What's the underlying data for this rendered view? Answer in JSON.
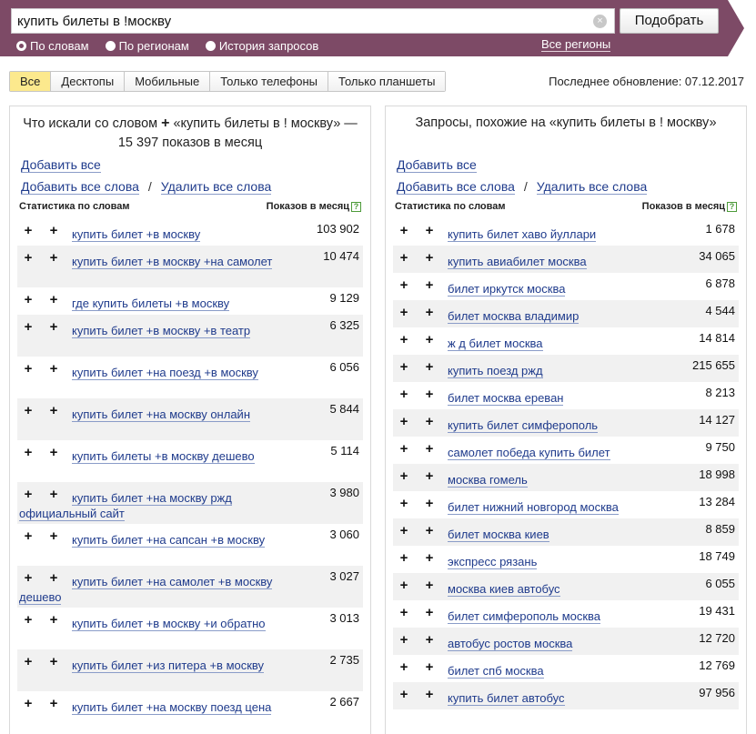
{
  "search": {
    "value": "купить билеты в !москву",
    "submit_label": "Подобрать",
    "modes": [
      {
        "label": "По словам",
        "checked": true
      },
      {
        "label": "По регионам",
        "checked": false
      },
      {
        "label": "История запросов",
        "checked": false
      }
    ],
    "all_regions_label": "Все регионы"
  },
  "device_tabs": [
    {
      "label": "Все",
      "active": true
    },
    {
      "label": "Десктопы",
      "active": false
    },
    {
      "label": "Мобильные",
      "active": false
    },
    {
      "label": "Только телефоны",
      "active": false
    },
    {
      "label": "Только планшеты",
      "active": false
    }
  ],
  "last_update": "Последнее обновление: 07.12.2017",
  "colors": {
    "accent": "#7d4a66",
    "link": "#1f3b8c",
    "active_tab": "#fce98d"
  },
  "left_panel": {
    "title_before": "Что искали со словом",
    "title_after": "«купить билеты в ! москву» — 15 397 показов в месяц",
    "add_all": "Добавить все",
    "add_all_words": "Добавить все слова",
    "separator": "/",
    "delete_all_words": "Удалить все слова",
    "col_stats": "Статистика по словам",
    "col_impressions": "Показов в месяц",
    "help_label": "?",
    "rows": [
      {
        "phrase": "купить билет +в москву",
        "count": "103 902"
      },
      {
        "phrase": "купить билет +в москву +на самолет",
        "count": "10 474"
      },
      {
        "phrase": "где купить билеты +в москву",
        "count": "9 129"
      },
      {
        "phrase": "купить билет +в москву +в театр",
        "count": "6 325"
      },
      {
        "phrase": "купить билет +на поезд +в москву",
        "count": "6 056"
      },
      {
        "phrase": "купить билет +на москву онлайн",
        "count": "5 844"
      },
      {
        "phrase": "купить билеты +в москву дешево",
        "count": "5 114"
      },
      {
        "phrase": "купить билет +на москву ржд официальный сайт",
        "count": "3 980"
      },
      {
        "phrase": "купить билет +на сапсан +в москву",
        "count": "3 060"
      },
      {
        "phrase": "купить билет +на самолет +в москву дешево",
        "count": "3 027"
      },
      {
        "phrase": "купить билет +в москву +и обратно",
        "count": "3 013"
      },
      {
        "phrase": "купить билет +из питера +в москву",
        "count": "2 735"
      },
      {
        "phrase": "купить билет +на москву поезд цена",
        "count": "2 667"
      }
    ]
  },
  "right_panel": {
    "title": "Запросы, похожие на «купить билеты в ! москву»",
    "add_all": "Добавить все",
    "add_all_words": "Добавить все слова",
    "separator": "/",
    "delete_all_words": "Удалить все слова",
    "col_stats": "Статистика по словам",
    "col_impressions": "Показов в месяц",
    "help_label": "?",
    "rows": [
      {
        "phrase": "купить билет хаво йуллари",
        "count": "1 678"
      },
      {
        "phrase": "купить авиабилет москва",
        "count": "34 065"
      },
      {
        "phrase": "билет иркутск москва",
        "count": "6 878"
      },
      {
        "phrase": "билет москва владимир",
        "count": "4 544"
      },
      {
        "phrase": "ж д билет москва",
        "count": "14 814"
      },
      {
        "phrase": "купить поезд ржд",
        "count": "215 655"
      },
      {
        "phrase": "билет москва ереван",
        "count": "8 213"
      },
      {
        "phrase": "купить билет симферополь",
        "count": "14 127"
      },
      {
        "phrase": "самолет победа купить билет",
        "count": "9 750"
      },
      {
        "phrase": "москва гомель",
        "count": "18 998"
      },
      {
        "phrase": "билет нижний новгород москва",
        "count": "13 284"
      },
      {
        "phrase": "билет москва киев",
        "count": "8 859"
      },
      {
        "phrase": "экспресс рязань",
        "count": "18 749"
      },
      {
        "phrase": "москва киев автобус",
        "count": "6 055"
      },
      {
        "phrase": "билет симферополь москва",
        "count": "19 431"
      },
      {
        "phrase": "автобус ростов москва",
        "count": "12 720"
      },
      {
        "phrase": "билет спб москва",
        "count": "12 769"
      },
      {
        "phrase": "купить билет автобус",
        "count": "97 956"
      }
    ]
  }
}
